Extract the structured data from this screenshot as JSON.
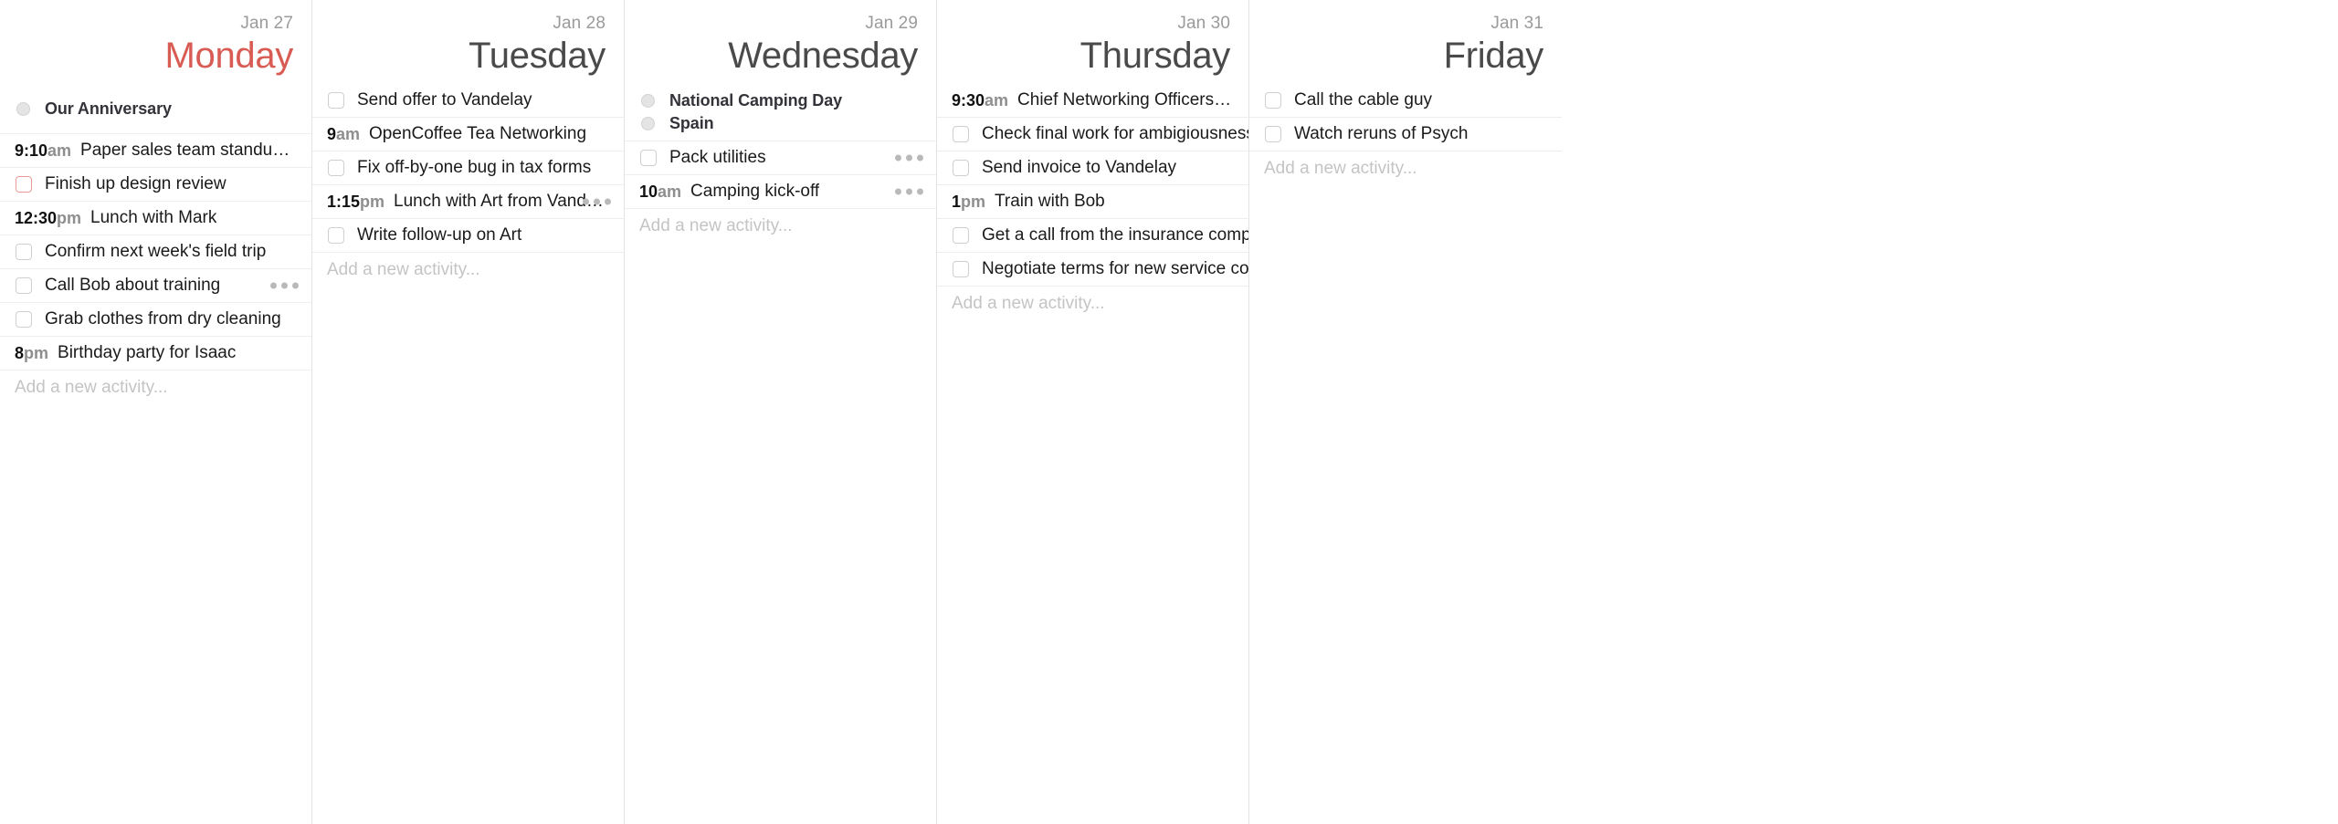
{
  "app": {
    "view": "week-agenda",
    "add_placeholder": "Add a new activity...",
    "accent_color": "#d85c53",
    "muted_color": "#9b9b9b",
    "checkbox_highlight_color": "#e79b94",
    "dots_icon": "ellipsis-icon"
  },
  "days": [
    {
      "date": "Jan 27",
      "name": "Monday",
      "is_today": true,
      "holidays": [
        {
          "label": "Our Anniversary",
          "icon": "circle-bullet-icon"
        }
      ],
      "items": [
        {
          "type": "event",
          "time": "9:10",
          "suffix": "am",
          "label": "Paper sales team standup meeting",
          "menu": false
        },
        {
          "type": "task",
          "label": "Finish up design review",
          "highlight": true,
          "menu": false
        },
        {
          "type": "event",
          "time": "12:30",
          "suffix": "pm",
          "label": "Lunch with Mark",
          "menu": false
        },
        {
          "type": "task",
          "label": "Confirm next week's field trip",
          "highlight": false,
          "menu": false
        },
        {
          "type": "task",
          "label": "Call Bob about training",
          "highlight": false,
          "menu": true
        },
        {
          "type": "task",
          "label": "Grab clothes from dry cleaning",
          "highlight": false,
          "menu": false
        },
        {
          "type": "event",
          "time": "8",
          "suffix": "pm",
          "label": "Birthday party for Isaac",
          "menu": false
        }
      ]
    },
    {
      "date": "Jan 28",
      "name": "Tuesday",
      "is_today": false,
      "holidays": [],
      "items": [
        {
          "type": "task",
          "label": "Send offer to Vandelay",
          "highlight": false,
          "menu": false
        },
        {
          "type": "event",
          "time": "9",
          "suffix": "am",
          "label": "OpenCoffee Tea Networking",
          "menu": false
        },
        {
          "type": "task",
          "label": "Fix off-by-one bug in tax forms",
          "highlight": false,
          "menu": false
        },
        {
          "type": "event",
          "time": "1:15",
          "suffix": "pm",
          "label": "Lunch with Art from Vandelay I...",
          "menu": true
        },
        {
          "type": "task",
          "label": "Write follow-up on Art",
          "highlight": false,
          "menu": false
        }
      ]
    },
    {
      "date": "Jan 29",
      "name": "Wednesday",
      "is_today": false,
      "holidays": [
        {
          "label": "National Camping Day",
          "icon": "circle-bullet-icon"
        },
        {
          "label": "Spain",
          "icon": "circle-bullet-icon"
        }
      ],
      "items": [
        {
          "type": "task",
          "label": "Pack utilities",
          "highlight": false,
          "menu": true
        },
        {
          "type": "event",
          "time": "10",
          "suffix": "am",
          "label": "Camping kick-off",
          "menu": true
        }
      ]
    },
    {
      "date": "Jan 30",
      "name": "Thursday",
      "is_today": false,
      "holidays": [],
      "items": [
        {
          "type": "event",
          "time": "9:30",
          "suffix": "am",
          "label": "Chief Networking Officers Event",
          "menu": false
        },
        {
          "type": "task",
          "label": "Check final work for ambigiousness",
          "highlight": false,
          "menu": false
        },
        {
          "type": "task",
          "label": "Send invoice to Vandelay",
          "highlight": false,
          "menu": false
        },
        {
          "type": "event",
          "time": "1",
          "suffix": "pm",
          "label": "Train with Bob",
          "menu": false
        },
        {
          "type": "task",
          "label": "Get a call from the insurance company",
          "highlight": false,
          "menu": false
        },
        {
          "type": "task",
          "label": "Negotiate terms for new service contract",
          "highlight": false,
          "menu": false
        }
      ]
    },
    {
      "date": "Jan 31",
      "name": "Friday",
      "is_today": false,
      "holidays": [],
      "items": [
        {
          "type": "task",
          "label": "Call the cable guy",
          "highlight": false,
          "menu": false
        },
        {
          "type": "task",
          "label": "Watch reruns of Psych",
          "highlight": false,
          "menu": false
        }
      ]
    }
  ]
}
